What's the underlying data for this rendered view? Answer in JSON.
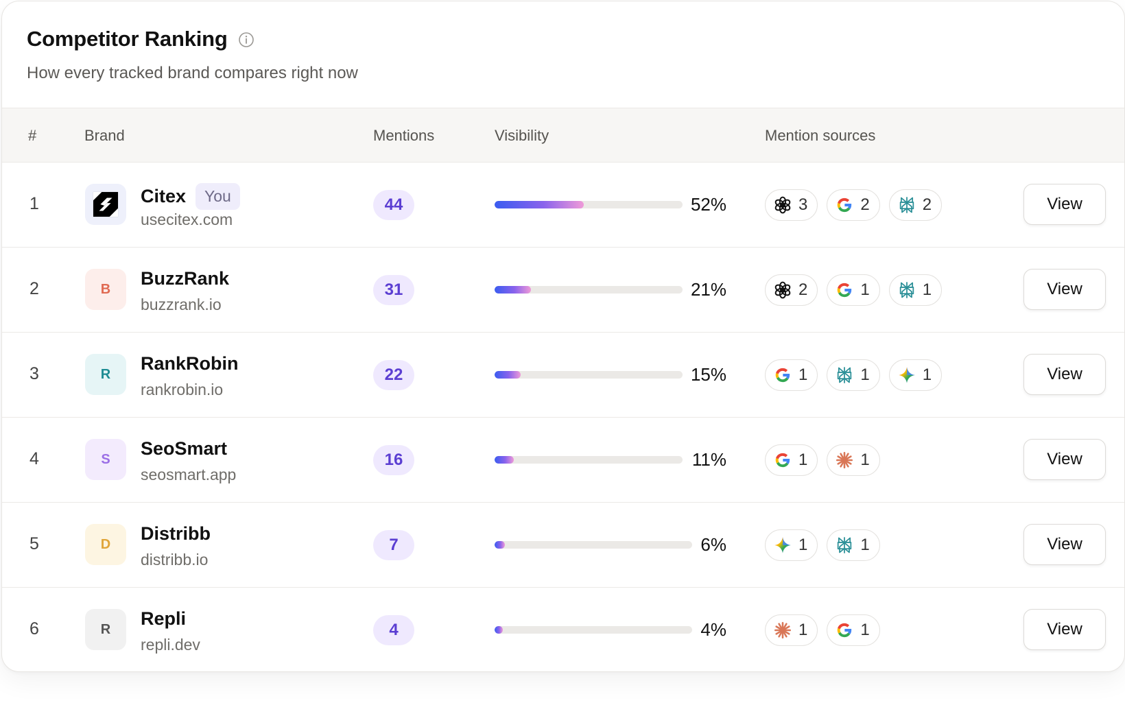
{
  "header": {
    "title": "Competitor Ranking",
    "subtitle": "How every tracked brand compares right now",
    "info_icon": "info-icon"
  },
  "columns": {
    "rank": "#",
    "brand": "Brand",
    "mentions": "Mentions",
    "visibility": "Visibility",
    "sources": "Mention sources"
  },
  "view_label": "View",
  "you_label": "You",
  "rows": [
    {
      "rank": "1",
      "name": "Citex",
      "domain": "usecitex.com",
      "is_you": true,
      "logo_letter": "",
      "logo_icon": "citex-logo-icon",
      "logo_bg": "#eef0fb",
      "logo_fg": "#000000",
      "mentions": "44",
      "visibility": "52%",
      "visibility_value": 0.52,
      "sources": [
        {
          "icon": "openai-icon",
          "count": "3"
        },
        {
          "icon": "google-icon",
          "count": "2"
        },
        {
          "icon": "perplexity-icon",
          "count": "2"
        }
      ]
    },
    {
      "rank": "2",
      "name": "BuzzRank",
      "domain": "buzzrank.io",
      "is_you": false,
      "logo_letter": "B",
      "logo_bg": "#fdeeeb",
      "logo_fg": "#e06a52",
      "mentions": "31",
      "visibility": "21%",
      "visibility_value": 0.21,
      "sources": [
        {
          "icon": "openai-icon",
          "count": "2"
        },
        {
          "icon": "google-icon",
          "count": "1"
        },
        {
          "icon": "perplexity-icon",
          "count": "1"
        }
      ]
    },
    {
      "rank": "3",
      "name": "RankRobin",
      "domain": "rankrobin.io",
      "is_you": false,
      "logo_letter": "R",
      "logo_bg": "#e6f5f6",
      "logo_fg": "#1e8c93",
      "mentions": "22",
      "visibility": "15%",
      "visibility_value": 0.15,
      "sources": [
        {
          "icon": "google-icon",
          "count": "1"
        },
        {
          "icon": "perplexity-icon",
          "count": "1"
        },
        {
          "icon": "gemini-icon",
          "count": "1"
        }
      ]
    },
    {
      "rank": "4",
      "name": "SeoSmart",
      "domain": "seosmart.app",
      "is_you": false,
      "logo_letter": "S",
      "logo_bg": "#f3ebfd",
      "logo_fg": "#9b6ee6",
      "mentions": "16",
      "visibility": "11%",
      "visibility_value": 0.11,
      "sources": [
        {
          "icon": "google-icon",
          "count": "1"
        },
        {
          "icon": "claude-icon",
          "count": "1"
        }
      ]
    },
    {
      "rank": "5",
      "name": "Distribb",
      "domain": "distribb.io",
      "is_you": false,
      "logo_letter": "D",
      "logo_bg": "#fdf5e2",
      "logo_fg": "#e0a53a",
      "mentions": "7",
      "visibility": "6%",
      "visibility_value": 0.06,
      "sources": [
        {
          "icon": "gemini-icon",
          "count": "1"
        },
        {
          "icon": "perplexity-icon",
          "count": "1"
        }
      ]
    },
    {
      "rank": "6",
      "name": "Repli",
      "domain": "repli.dev",
      "is_you": false,
      "logo_letter": "R",
      "logo_bg": "#f1f1f1",
      "logo_fg": "#555555",
      "mentions": "4",
      "visibility": "4%",
      "visibility_value": 0.04,
      "sources": [
        {
          "icon": "claude-icon",
          "count": "1"
        },
        {
          "icon": "google-icon",
          "count": "1"
        }
      ]
    }
  ]
}
